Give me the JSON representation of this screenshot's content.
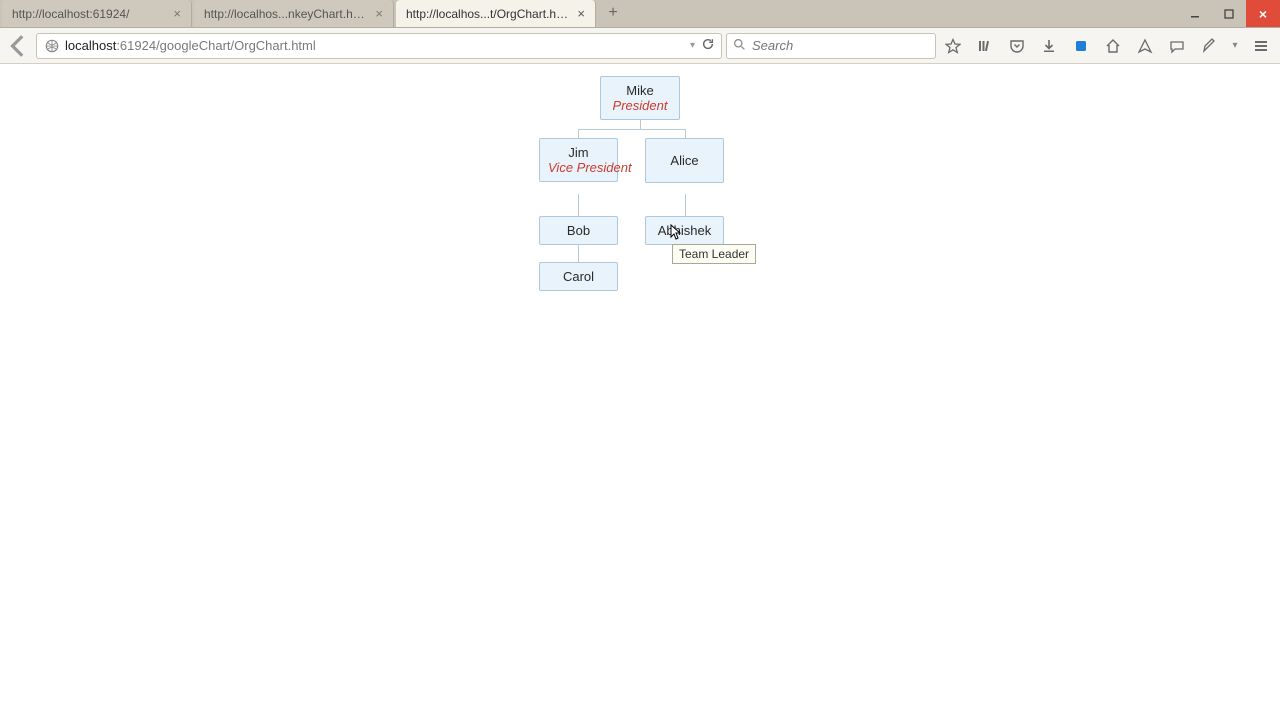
{
  "window": {
    "tabs": [
      {
        "label": "http://localhost:61924/",
        "active": false
      },
      {
        "label": "http://localhos...nkeyChart.html",
        "active": false
      },
      {
        "label": "http://localhos...t/OrgChart.html",
        "active": true
      }
    ],
    "newtab": "+"
  },
  "toolbar": {
    "url_host": "localhost",
    "url_portpath": ":61924/googleChart/OrgChart.html",
    "search_placeholder": "Search"
  },
  "chart": {
    "nodes": {
      "mike": {
        "name": "Mike",
        "title": "President"
      },
      "jim": {
        "name": "Jim",
        "title": "Vice President"
      },
      "alice": {
        "name": "Alice",
        "title": ""
      },
      "bob": {
        "name": "Bob",
        "title": ""
      },
      "abhishek": {
        "name": "Abhishek",
        "title": ""
      },
      "carol": {
        "name": "Carol",
        "title": ""
      }
    },
    "tooltip": "Team Leader"
  },
  "chart_data": {
    "type": "org",
    "title": "",
    "nodes": [
      {
        "id": "mike",
        "name": "Mike",
        "title": "President",
        "parent": null
      },
      {
        "id": "jim",
        "name": "Jim",
        "title": "Vice President",
        "parent": "mike"
      },
      {
        "id": "alice",
        "name": "Alice",
        "title": "",
        "parent": "mike"
      },
      {
        "id": "bob",
        "name": "Bob",
        "title": "",
        "parent": "jim"
      },
      {
        "id": "abhishek",
        "name": "Abhishek",
        "title": "Team Leader",
        "parent": "alice"
      },
      {
        "id": "carol",
        "name": "Carol",
        "title": "",
        "parent": "bob"
      }
    ]
  }
}
